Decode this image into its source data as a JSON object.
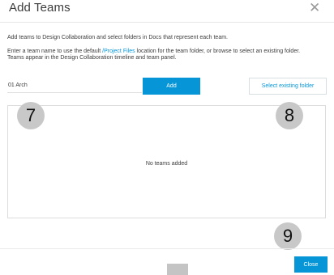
{
  "dialog": {
    "title": "Add Teams",
    "close_icon": "close-icon"
  },
  "intro": "Add teams to Design Collaboration and select folders in Docs that represent each team.",
  "instructions": {
    "part1": "Enter a team name to use the default ",
    "link": "/Project Files",
    "part2": " location for the team folder, or browse to select an existing folder. Teams appear in the Design Collaboration timeline and team panel."
  },
  "team_input": {
    "value": "01 Arch",
    "placeholder": ""
  },
  "add_button": "Add",
  "select_folder_button": "Select existing folder",
  "teams_list": {
    "empty_message": "No teams added"
  },
  "markers": [
    "7",
    "8",
    "9"
  ],
  "footer": {
    "close_button": "Close"
  },
  "colors": {
    "accent": "#0696d7",
    "marker": "#c8c8c8"
  }
}
